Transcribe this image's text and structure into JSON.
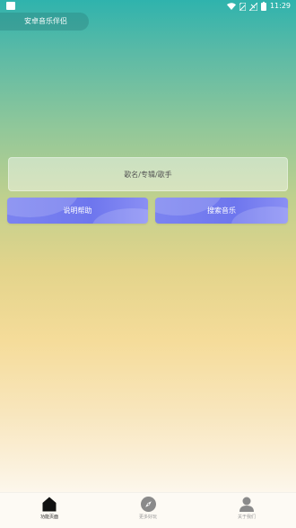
{
  "status_bar": {
    "time": "11:29"
  },
  "header": {
    "title": "安卓音乐伴侣"
  },
  "search": {
    "placeholder": "歌名/专辑/歌手",
    "value": ""
  },
  "buttons": {
    "help_label": "说明帮助",
    "search_label": "搜索音乐"
  },
  "tab_bar": {
    "tabs": [
      {
        "label": "功能页面",
        "icon": "home-icon",
        "active": true
      },
      {
        "label": "更多好玩",
        "icon": "compass-icon",
        "active": false
      },
      {
        "label": "关于我们",
        "icon": "person-icon",
        "active": false
      }
    ]
  },
  "colors": {
    "accent": "#737bef",
    "tab_active": "#222222",
    "tab_inactive": "#999999"
  }
}
